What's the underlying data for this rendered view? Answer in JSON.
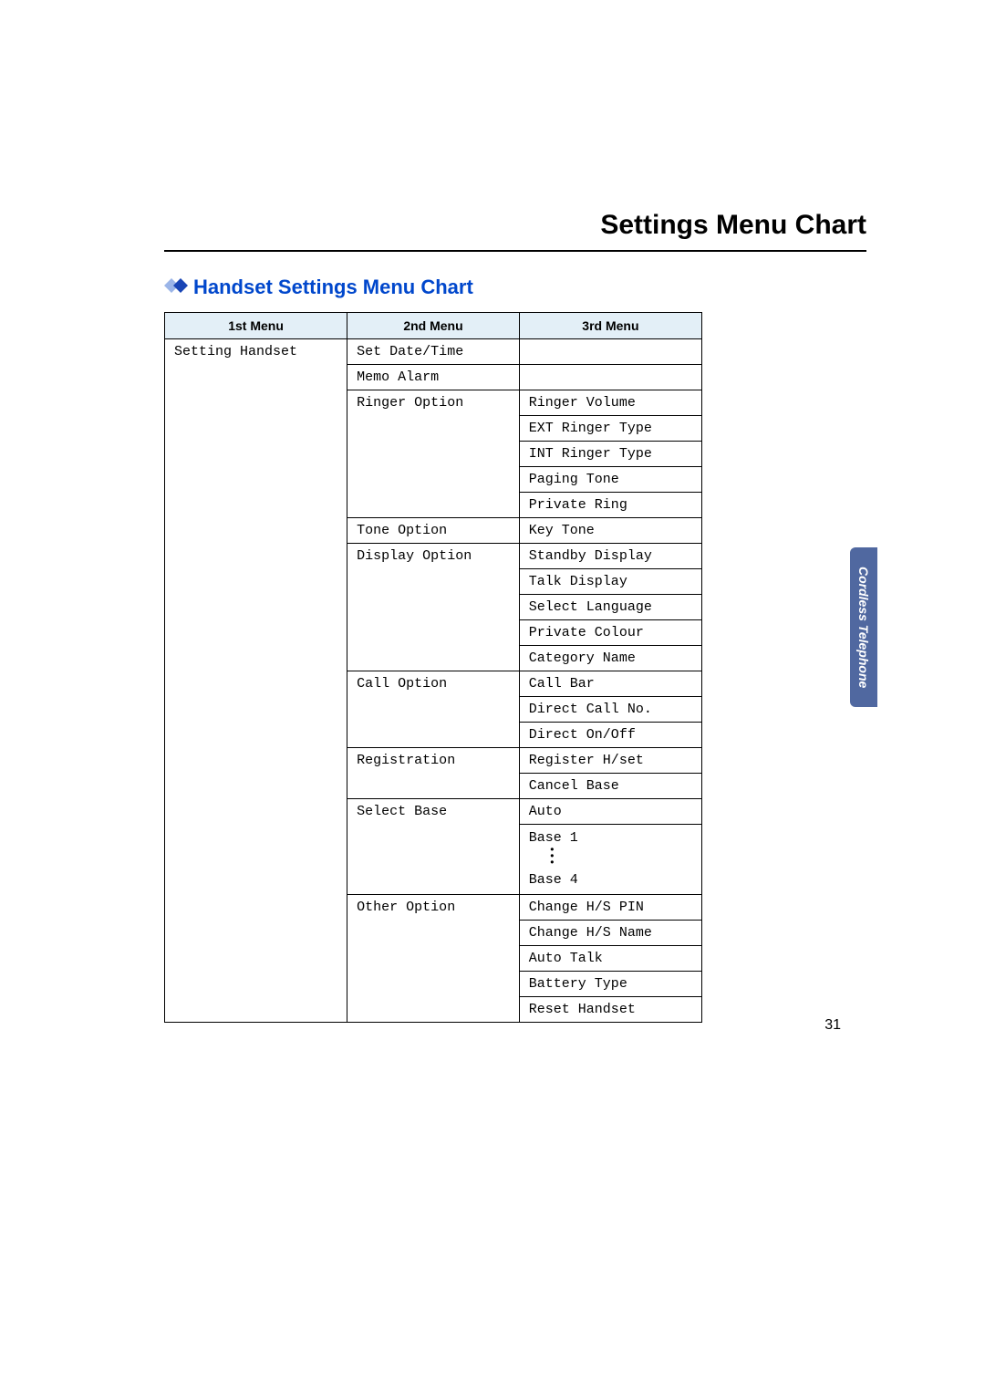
{
  "page": {
    "title": "Settings Menu Chart",
    "number": "31"
  },
  "section": {
    "title": "Handset Settings Menu Chart"
  },
  "sideTab": {
    "label": "Cordless Telephone"
  },
  "table": {
    "headers": {
      "col1": "1st Menu",
      "col2": "2nd Menu",
      "col3": "3rd Menu"
    },
    "cells": {
      "r0c0": "Setting Handset",
      "r0c1": "Set Date/Time",
      "r0c2": "",
      "r1c1": "Memo Alarm",
      "r1c2": "",
      "r2c1": "Ringer Option",
      "r2c2": "Ringer Volume",
      "r3c2": "EXT Ringer Type",
      "r4c2": "INT Ringer Type",
      "r5c2": "Paging Tone",
      "r6c2": "Private Ring",
      "r7c1": "Tone Option",
      "r7c2": "Key Tone",
      "r8c1": "Display Option",
      "r8c2": "Standby Display",
      "r9c2": "Talk Display",
      "r10c2": "Select Language",
      "r11c2": "Private Colour",
      "r12c2": "Category Name",
      "r13c1": "Call Option",
      "r13c2": "Call Bar",
      "r14c2": "Direct Call No.",
      "r15c2": "Direct On/Off",
      "r16c1": "Registration",
      "r16c2": "Register H/set",
      "r17c2": "Cancel Base",
      "r18c1": "Select Base",
      "r18c2": "Auto",
      "r19c2a": "Base 1",
      "r19c2b": "Base 4",
      "r20c1": "Other Option",
      "r20c2": "Change H/S PIN",
      "r21c2": "Change H/S Name",
      "r22c2": "Auto Talk",
      "r23c2": "Battery Type",
      "r24c2": "Reset Handset"
    }
  }
}
